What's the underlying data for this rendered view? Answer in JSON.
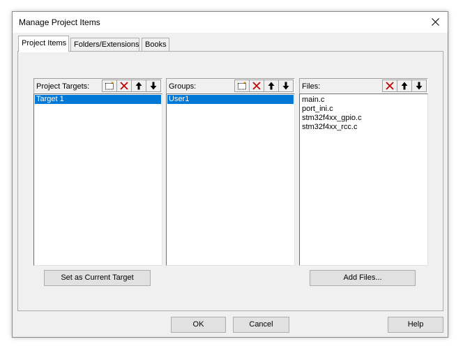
{
  "window": {
    "title": "Manage Project Items"
  },
  "tabs": [
    {
      "label": "Project Items"
    },
    {
      "label": "Folders/Extensions"
    },
    {
      "label": "Books"
    }
  ],
  "targets": {
    "label": "Project Targets:",
    "items": [
      "Target 1"
    ],
    "selected": "Target 1"
  },
  "groups": {
    "label": "Groups:",
    "items": [
      "User1"
    ],
    "selected": "User1"
  },
  "files": {
    "label": "Files:",
    "items": [
      "main.c",
      "port_ini.c",
      "stm32f4xx_gpio.c",
      "stm32f4xx_rcc.c"
    ]
  },
  "buttons": {
    "set_current_target": "Set as Current Target",
    "add_files": "Add Files...",
    "ok": "OK",
    "cancel": "Cancel",
    "help": "Help"
  },
  "colors": {
    "selection": "#0078d7",
    "delete_icon": "#c00000"
  }
}
